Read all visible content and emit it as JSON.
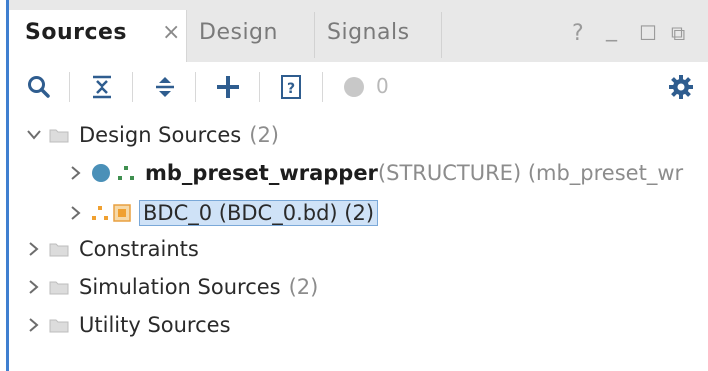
{
  "tabs": [
    {
      "label": "Sources",
      "active": true
    },
    {
      "label": "Design",
      "active": false
    },
    {
      "label": "Signals",
      "active": false
    }
  ],
  "window_controls": {
    "help": "?",
    "minimize": "_",
    "maximize": "☐",
    "restore": "⧉"
  },
  "toolbar": {
    "icons": [
      "search-icon",
      "collapse-all-icon",
      "expand-all-icon",
      "add-icon",
      "help-doc-icon",
      "status-circle-icon",
      "settings-icon"
    ],
    "status_count": "0"
  },
  "tree": {
    "design_sources": {
      "label": "Design Sources",
      "count": "(2)"
    },
    "mb_wrapper": {
      "name": "mb_preset_wrapper",
      "detail": "(STRUCTURE) (mb_preset_wr"
    },
    "bdc": {
      "label": "BDC_0 (BDC_0.bd) (2)"
    },
    "constraints": {
      "label": "Constraints"
    },
    "simulation_sources": {
      "label": "Simulation Sources",
      "count": "(2)"
    },
    "utility_sources": {
      "label": "Utility Sources"
    }
  },
  "colors": {
    "accent": "#3f7fd0",
    "selection": "#cfe2f7",
    "status_dot": "#4a90b8",
    "bd_orange": "#f0a030"
  }
}
